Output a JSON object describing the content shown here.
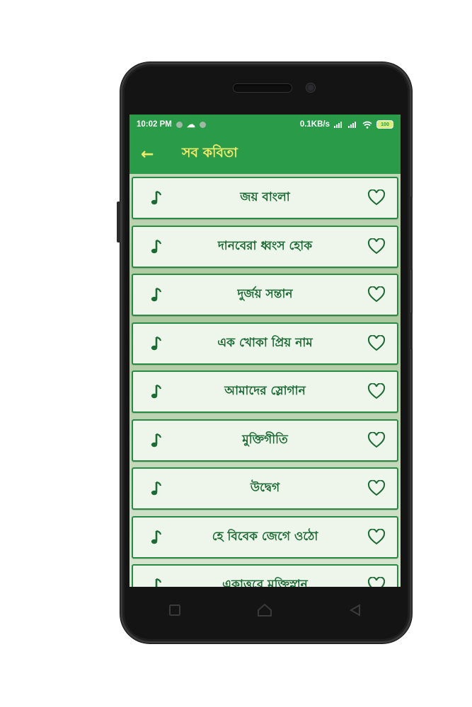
{
  "statusbar": {
    "time": "10:02 PM",
    "net_speed": "0.1KB/s",
    "battery": "100"
  },
  "appbar": {
    "back_icon": "arrow-left-icon",
    "title": "সব কবিতা"
  },
  "poems": [
    {
      "title": "জয় বাংলা"
    },
    {
      "title": "দানবেরা ধ্বংস হোক"
    },
    {
      "title": "দুর্জয় সন্তান"
    },
    {
      "title": "এক খোকা প্রিয় নাম"
    },
    {
      "title": "আমাদের স্লোগান"
    },
    {
      "title": "মুক্তিগীতি"
    },
    {
      "title": "উদ্বেগ"
    },
    {
      "title": "হে বিবেক জেগে ওঠো"
    },
    {
      "title": "একাত্তরে মুক্তিস্নান"
    }
  ],
  "colors": {
    "primary": "#2a9b49",
    "title_accent": "#f4ea6b",
    "item_text": "#1d6a35",
    "item_border": "#2a8a45"
  }
}
